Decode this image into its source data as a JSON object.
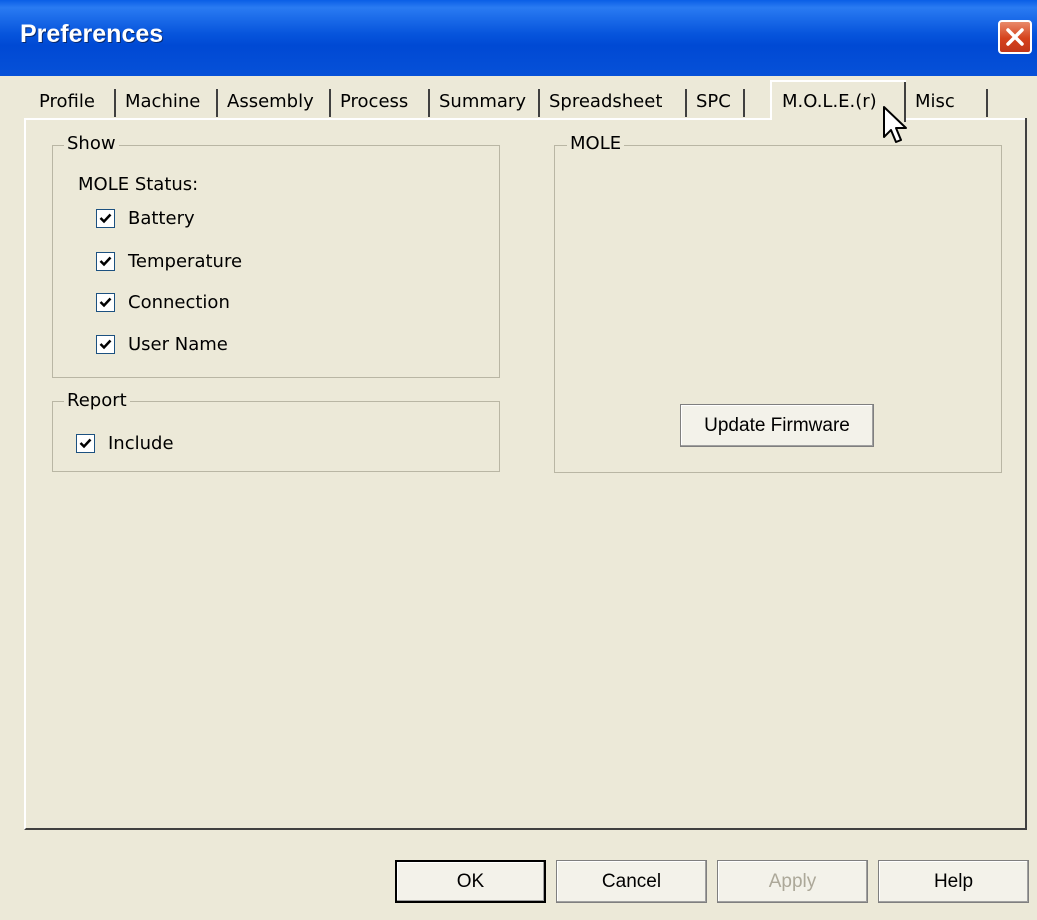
{
  "window": {
    "title": "Preferences"
  },
  "tabs": [
    {
      "label": "Profile"
    },
    {
      "label": "Machine"
    },
    {
      "label": "Assembly"
    },
    {
      "label": "Process"
    },
    {
      "label": "Summary"
    },
    {
      "label": "Spreadsheet"
    },
    {
      "label": "SPC"
    },
    {
      "label": "M.O.L.E.(r)"
    },
    {
      "label": "Misc"
    }
  ],
  "active_tab": "M.O.L.E.(r)",
  "show_group": {
    "label": "Show",
    "status_label": "MOLE Status:",
    "items": [
      {
        "label": "Battery",
        "checked": true
      },
      {
        "label": "Temperature",
        "checked": true
      },
      {
        "label": "Connection",
        "checked": true
      },
      {
        "label": "User Name",
        "checked": true
      }
    ]
  },
  "report_group": {
    "label": "Report",
    "include": {
      "label": "Include",
      "checked": true
    }
  },
  "mole_group": {
    "label": "MOLE",
    "update_button": "Update Firmware"
  },
  "footer": {
    "ok": "OK",
    "cancel": "Cancel",
    "apply": "Apply",
    "help": "Help"
  },
  "colors": {
    "titlebar": "#0654dc",
    "dialog_bg": "#ece9d8",
    "close_button": "#d5421c"
  },
  "icons": {
    "close": "close-icon",
    "check": "checkmark-icon",
    "cursor": "mouse-cursor-icon"
  }
}
